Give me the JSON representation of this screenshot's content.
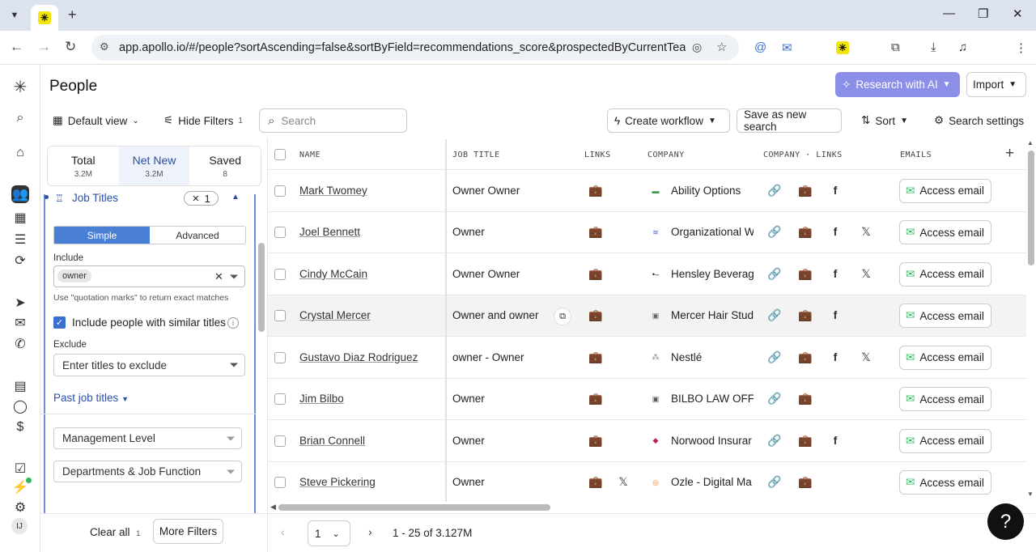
{
  "browser": {
    "url": "app.apollo.io/#/people?sortAscending=false&sortByField=recommendations_score&prospectedByCurrentTeam[]=no&...",
    "new_tab": "+",
    "minimize": "—",
    "restore": "❐",
    "close": "✕"
  },
  "header": {
    "title": "People",
    "research_label": "Research with AI",
    "import_label": "Import"
  },
  "toolbar": {
    "default_view": "Default view",
    "hide_filters": "Hide Filters",
    "hide_filters_count": "1",
    "search_placeholder": "Search",
    "create_workflow": "Create workflow",
    "save_search": "Save as new search",
    "sort": "Sort",
    "search_settings": "Search settings"
  },
  "tabs": [
    {
      "label": "Total",
      "count": "3.2M"
    },
    {
      "label": "Net New",
      "count": "3.2M"
    },
    {
      "label": "Saved",
      "count": "8"
    }
  ],
  "filters": {
    "job_titles": "Job Titles",
    "job_titles_count": "1",
    "mode_simple": "Simple",
    "mode_advanced": "Advanced",
    "include_label": "Include",
    "include_value": "owner",
    "hint": "Use \"quotation marks\" to return exact matches",
    "similar_titles": "Include people with similar titles",
    "exclude_label": "Exclude",
    "exclude_placeholder": "Enter titles to exclude",
    "past_job_titles": "Past job titles",
    "management_level": "Management Level",
    "departments": "Departments & Job Function",
    "clear_all": "Clear all",
    "clear_count": "1",
    "more_filters": "More Filters"
  },
  "table": {
    "headers": {
      "name": "NAME",
      "job_title": "JOB TITLE",
      "links": "LINKS",
      "company": "COMPANY",
      "company_links": "COMPANY · LINKS",
      "emails": "EMAILS"
    },
    "access_email": "Access email",
    "rows": [
      {
        "name": "Mark Twomey",
        "title": "Owner Owner",
        "company": "Ability Options"
      },
      {
        "name": "Joel Bennett",
        "title": "Owner",
        "company": "Organizational W"
      },
      {
        "name": "Cindy McCain",
        "title": "Owner Owner",
        "company": "Hensley Beverag"
      },
      {
        "name": "Crystal Mercer",
        "title": "Owner and owner",
        "company": "Mercer Hair Stud"
      },
      {
        "name": "Gustavo Diaz Rodriguez",
        "title": "owner - Owner",
        "company": "Nestlé"
      },
      {
        "name": "Jim Bilbo",
        "title": "Owner",
        "company": "BILBO LAW OFF"
      },
      {
        "name": "Brian Connell",
        "title": "Owner",
        "company": "Norwood Insurar"
      },
      {
        "name": "Steve Pickering",
        "title": "Owner",
        "company": "Ozle - Digital Ma"
      }
    ]
  },
  "pagination": {
    "page": "1",
    "range": "1 - 25 of 3.127M"
  },
  "user_initials": "IJ",
  "help": "?"
}
